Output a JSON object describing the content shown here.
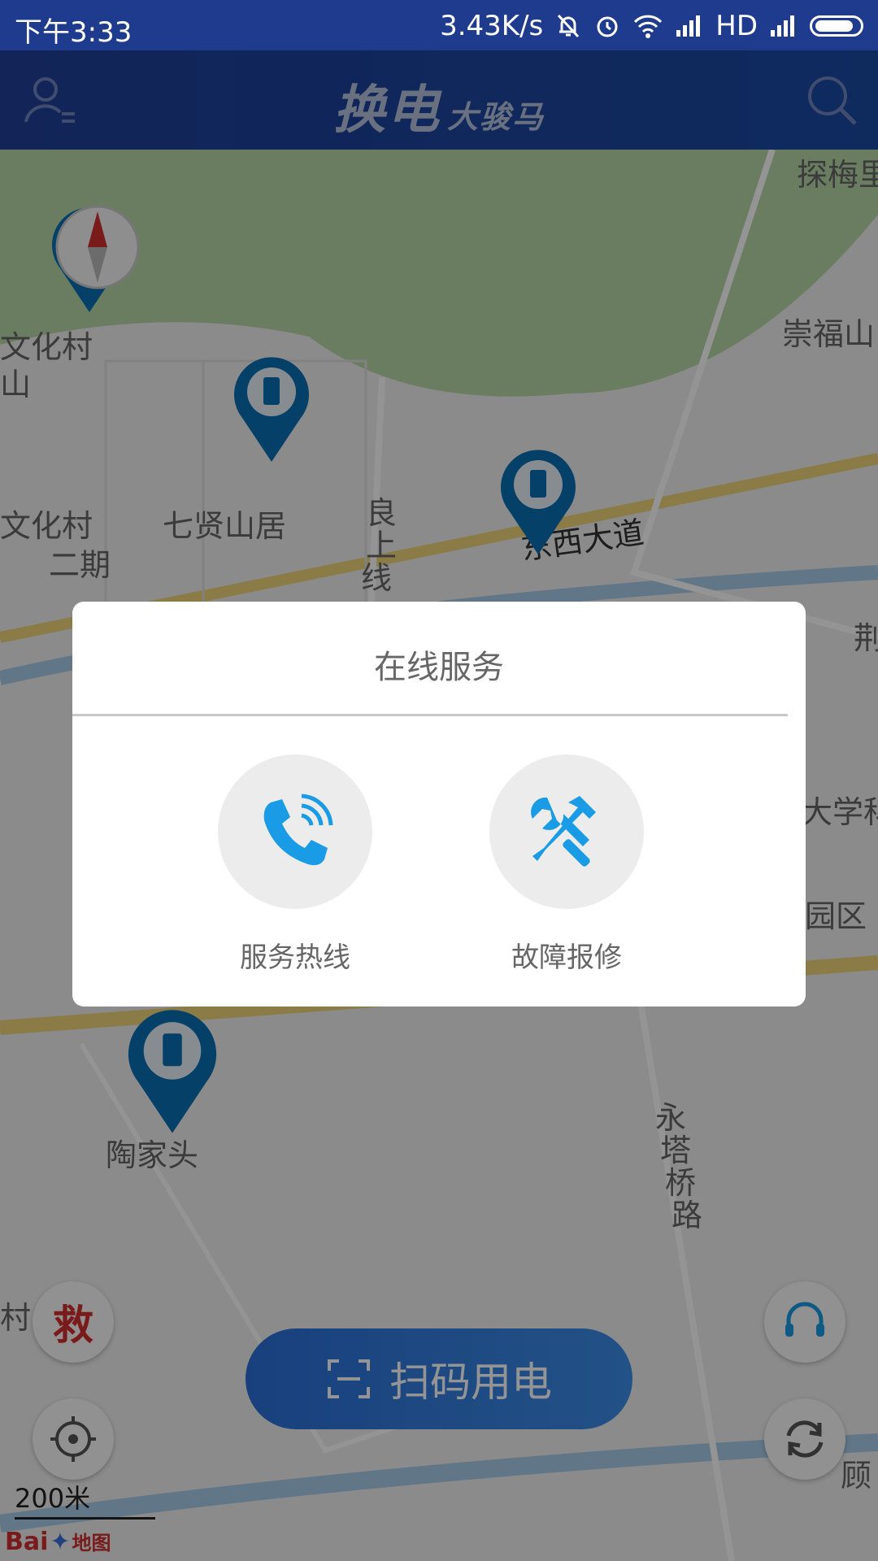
{
  "status_bar": {
    "time": "下午3:33",
    "speed": "3.43K/s",
    "hd": "HD"
  },
  "header": {
    "logo_main": "换电",
    "logo_sub": "大骏马"
  },
  "map": {
    "labels": [
      "探梅里",
      "文化村",
      "山",
      "崇福山",
      "七贤山居",
      "良",
      "上",
      "线",
      "东西大道",
      "文化村",
      "二期",
      "荆",
      "大学科",
      "园区",
      "陶家头",
      "永",
      "塔",
      "桥",
      "路",
      "村",
      "顾"
    ],
    "scale": "200米",
    "brand": "Bai",
    "brand_suffix": "地图"
  },
  "controls": {
    "rescue": "救",
    "scan_label": "扫码用电"
  },
  "dialog": {
    "title": "在线服务",
    "options": [
      {
        "label": "服务热线",
        "icon": "phone-icon"
      },
      {
        "label": "故障报修",
        "icon": "repair-tools-icon"
      }
    ]
  },
  "colors": {
    "header": "#1e3b8e",
    "accent": "#1a9be6",
    "marker": "#0a6fb5",
    "rescue": "#d32f2f"
  }
}
